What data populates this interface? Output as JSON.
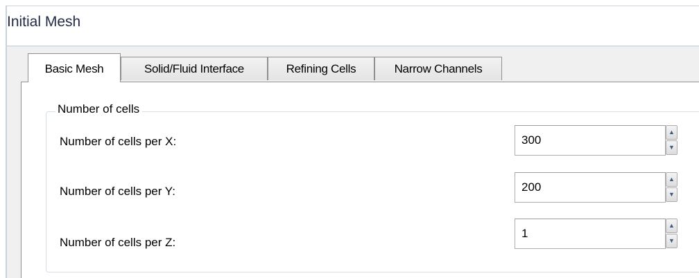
{
  "window": {
    "title": "Initial Mesh"
  },
  "tabs": [
    {
      "label": "Basic Mesh",
      "active": true
    },
    {
      "label": "Solid/Fluid Interface",
      "active": false
    },
    {
      "label": "Refining Cells",
      "active": false
    },
    {
      "label": "Narrow Channels",
      "active": false
    }
  ],
  "group": {
    "legend": "Number of cells"
  },
  "rows": [
    {
      "label": "Number of cells per X:",
      "value": "300"
    },
    {
      "label": "Number of cells per Y:",
      "value": "200"
    },
    {
      "label": "Number of cells per Z:",
      "value": "1"
    }
  ],
  "icons": {
    "spin_up": "spin-up-arrow-icon",
    "spin_down": "spin-down-arrow-icon"
  },
  "colors": {
    "title_text": "#1f2a44",
    "dialog_background": "#f0f0f0",
    "panel_background": "#ffffff",
    "spin_arrow": "#3d5a80"
  }
}
